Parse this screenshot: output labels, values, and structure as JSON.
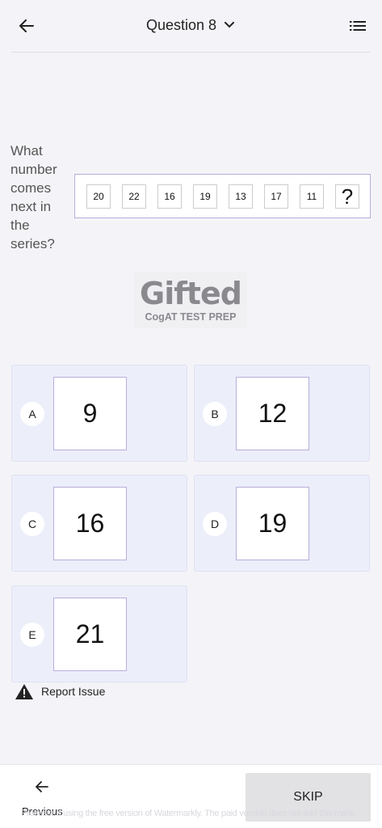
{
  "header": {
    "title": "Question 8",
    "back_icon": "arrow-left-icon",
    "dropdown_icon": "chevron-down-icon",
    "list_icon": "list-icon"
  },
  "question": {
    "text": "What number comes next in the series?",
    "series": [
      "20",
      "22",
      "16",
      "19",
      "13",
      "17",
      "11",
      "?"
    ]
  },
  "logo": {
    "name": "Gifted",
    "subtitle": "CogAT TEST PREP"
  },
  "options": [
    {
      "letter": "A",
      "value": "9"
    },
    {
      "letter": "B",
      "value": "12"
    },
    {
      "letter": "C",
      "value": "16"
    },
    {
      "letter": "D",
      "value": "19"
    },
    {
      "letter": "E",
      "value": "21"
    }
  ],
  "report": {
    "label": "Report Issue",
    "icon": "warning-icon"
  },
  "footer": {
    "previous_label": "Previous",
    "skip_label": "SKIP",
    "watermark": "Processed using the free version of Watermarkly. The paid version does not add this mark."
  },
  "colors": {
    "option_bg": "#eceefa",
    "box_border": "#b9addb",
    "skip_bg": "#e2e2e4"
  }
}
